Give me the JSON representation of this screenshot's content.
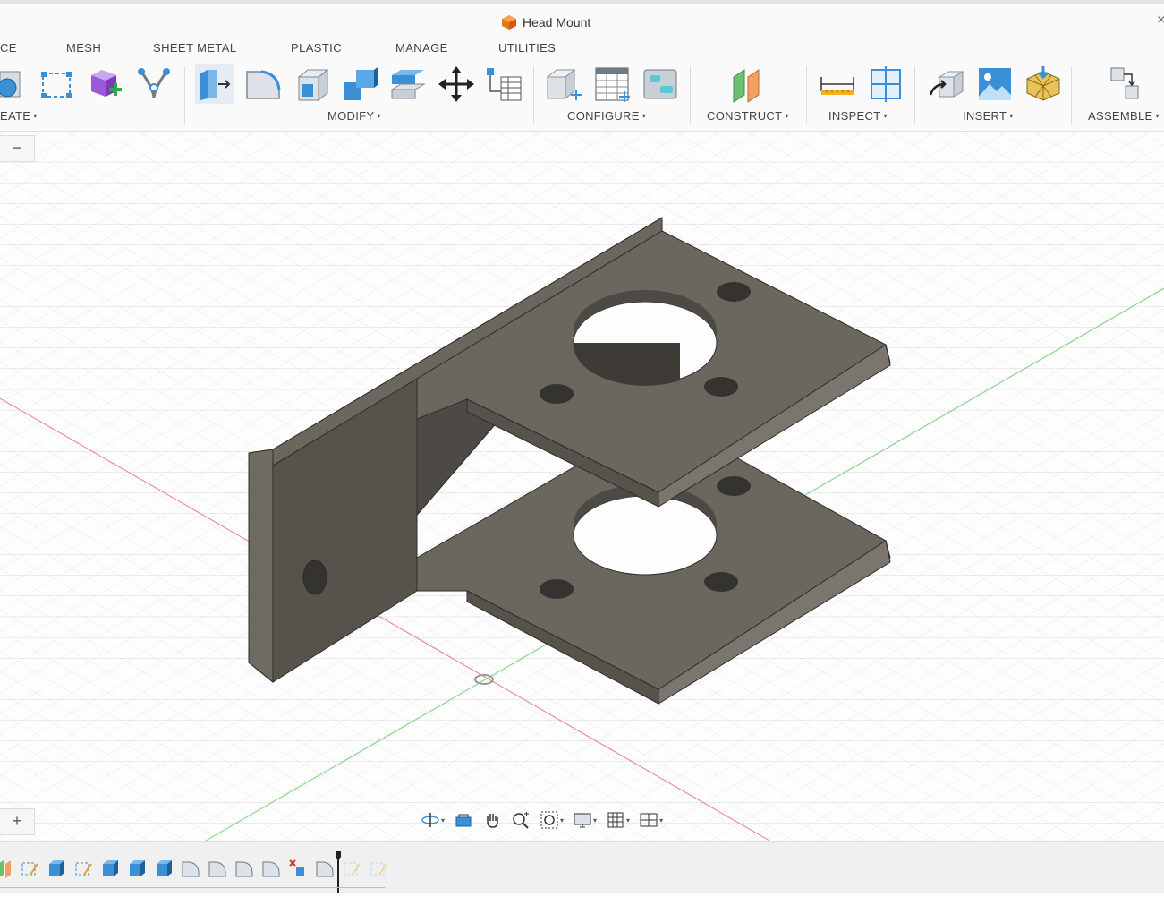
{
  "window": {
    "title": "Head Mount",
    "close_glyph": "×"
  },
  "tabs": [
    {
      "label": "CE"
    },
    {
      "label": "MESH"
    },
    {
      "label": "SHEET METAL"
    },
    {
      "label": "PLASTIC"
    },
    {
      "label": "MANAGE"
    },
    {
      "label": "UTILITIES"
    }
  ],
  "groups": {
    "create": "EATE",
    "modify": "MODIFY",
    "configure": "CONFIGURE",
    "construct": "CONSTRUCT",
    "inspect": "INSPECT",
    "insert": "INSERT",
    "assemble": "ASSEMBLE"
  },
  "caret_glyph": "▾",
  "viewport": {
    "collapse_button": "−",
    "expand_button": "+"
  },
  "colors": {
    "part_face": "#6b675f",
    "part_dark": "#4b4843",
    "part_edge": "#2e2c29",
    "accent_blue": "#3a8fd6",
    "x_axis": "#e88080",
    "y_axis": "#7ad07a"
  },
  "icons": {
    "title": "orange-cube-icon",
    "navigation": [
      "orbit-icon",
      "look-at-icon",
      "pan-icon",
      "zoom-icon",
      "zoom-window-icon",
      "display-settings-icon",
      "grid-icon",
      "viewports-icon"
    ]
  }
}
